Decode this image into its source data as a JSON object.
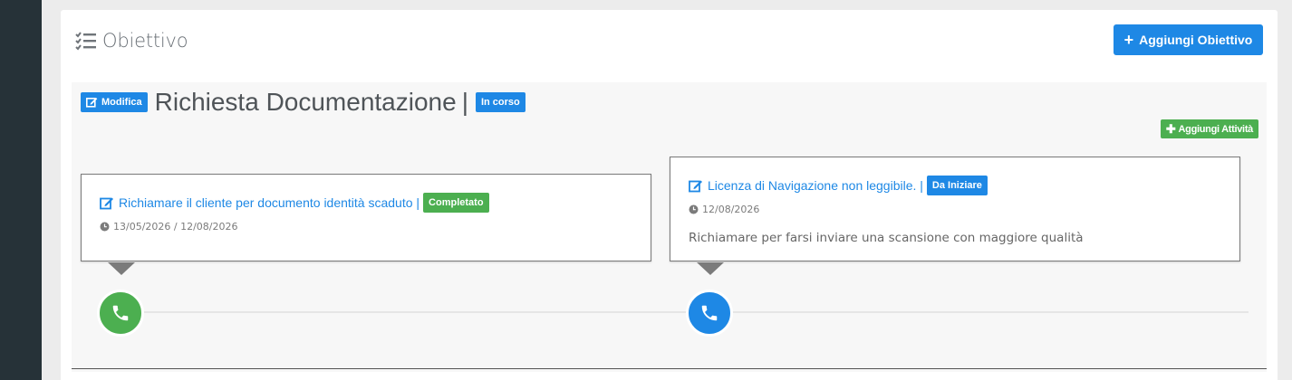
{
  "colors": {
    "primary": "#1e88e5",
    "success": "#4caf50",
    "sidebar": "#263238"
  },
  "header": {
    "title": "Obiettivo",
    "add_goal_label": "Aggiungi Obiettivo"
  },
  "goal": {
    "edit_label": "Modifica",
    "title": "Richiesta Documentazione",
    "separator": "|",
    "status": "In corso",
    "add_activity_label": "Aggiungi Attività"
  },
  "activities": [
    {
      "title": "Richiamare il cliente per documento identità scaduto |",
      "status": "Completato",
      "dates": "13/05/2026 / 12/08/2026",
      "description": "",
      "icon": "phone-icon",
      "status_color": "#4caf50"
    },
    {
      "title": "Licenza di Navigazione non leggibile. |",
      "status": "Da Iniziare",
      "dates": "12/08/2026",
      "description": "Richiamare per farsi inviare una scansione con maggiore qualità",
      "icon": "phone-icon",
      "status_color": "#1e88e5"
    }
  ]
}
